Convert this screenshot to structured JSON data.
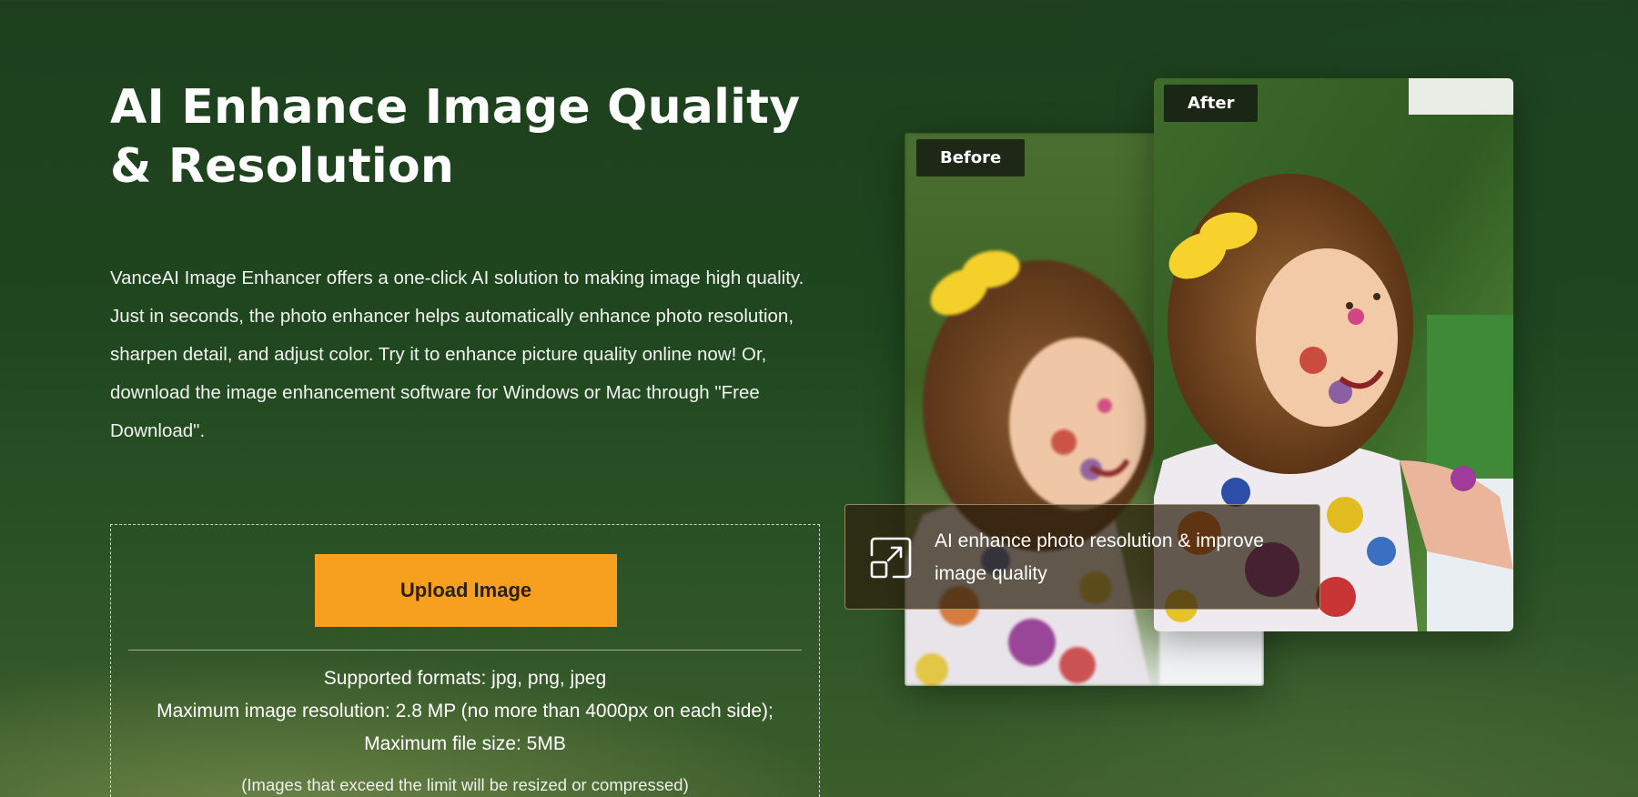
{
  "hero": {
    "title": "AI Enhance Image Quality & Resolution",
    "description": "VanceAI Image Enhancer offers a one-click AI solution to making image high quality. Just in seconds, the photo enhancer helps automatically enhance photo resolution, sharpen detail, and adjust color. Try it to enhance picture quality online now! Or, download the image enhancement software for Windows or Mac through \"Free Download\"."
  },
  "upload": {
    "button_label": "Upload Image",
    "supported_formats": "Supported formats: jpg, png, jpeg",
    "max_resolution": "Maximum image resolution: 2.8 MP (no more than 4000px on each side);",
    "max_file_size": "Maximum file size: 5MB",
    "note": "(Images that exceed the limit will be resized or compressed)"
  },
  "comparison": {
    "before_label": "Before",
    "after_label": "After",
    "feature_text": "AI enhance photo resolution & improve image quality",
    "feature_icon": "expand-arrow-icon"
  },
  "colors": {
    "accent": "#f7a01f",
    "background": "#1f461f",
    "label_bg": "#14180f"
  }
}
